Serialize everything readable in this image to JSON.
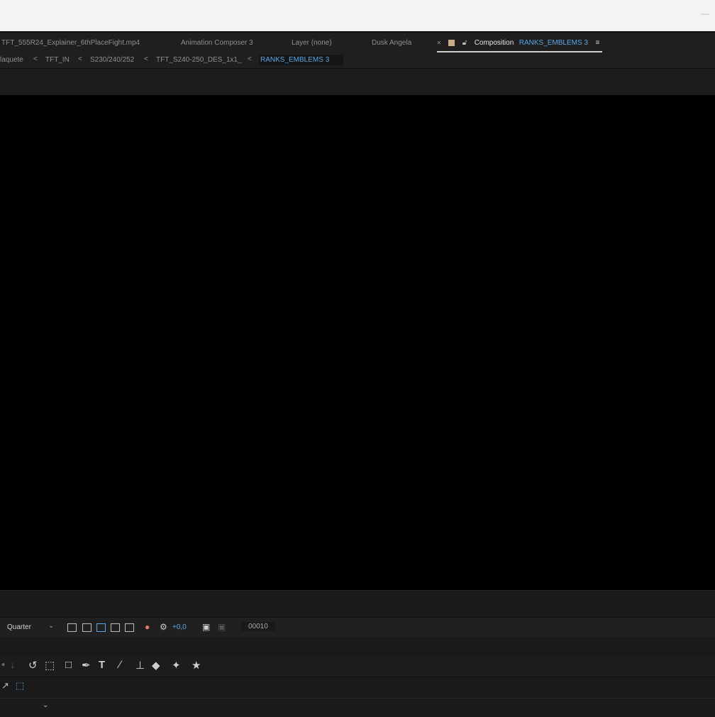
{
  "tabs": {
    "footage_tab": "TFT_555R24_Explainer_6thPlaceFight.mp4",
    "animation_composer_tab": "Animation Composer 3",
    "layer_tab": "Layer (none)",
    "dusk_tab": "Dusk Angela",
    "close_icon": "×",
    "composition_label": "Composition",
    "composition_name": "RANKS_EMBLEMS 3",
    "menu_icon": "≡"
  },
  "breadcrumbs": {
    "items": [
      "laquete",
      "TFT_IN",
      "S230/240/252",
      "TFT_S240-250_DES_1x1_",
      "RANKS_EMBLEMS 3"
    ],
    "separator": "<"
  },
  "viewer_controls": {
    "resolution": "Quarter",
    "exposure_value": "+0,0",
    "timecode": "00010"
  },
  "toolbar": {
    "text_tool": "T"
  },
  "colors": {
    "accent": "#5aa7e6",
    "viewer_bg": "#000000",
    "panel_bg": "#1d1d1d"
  }
}
